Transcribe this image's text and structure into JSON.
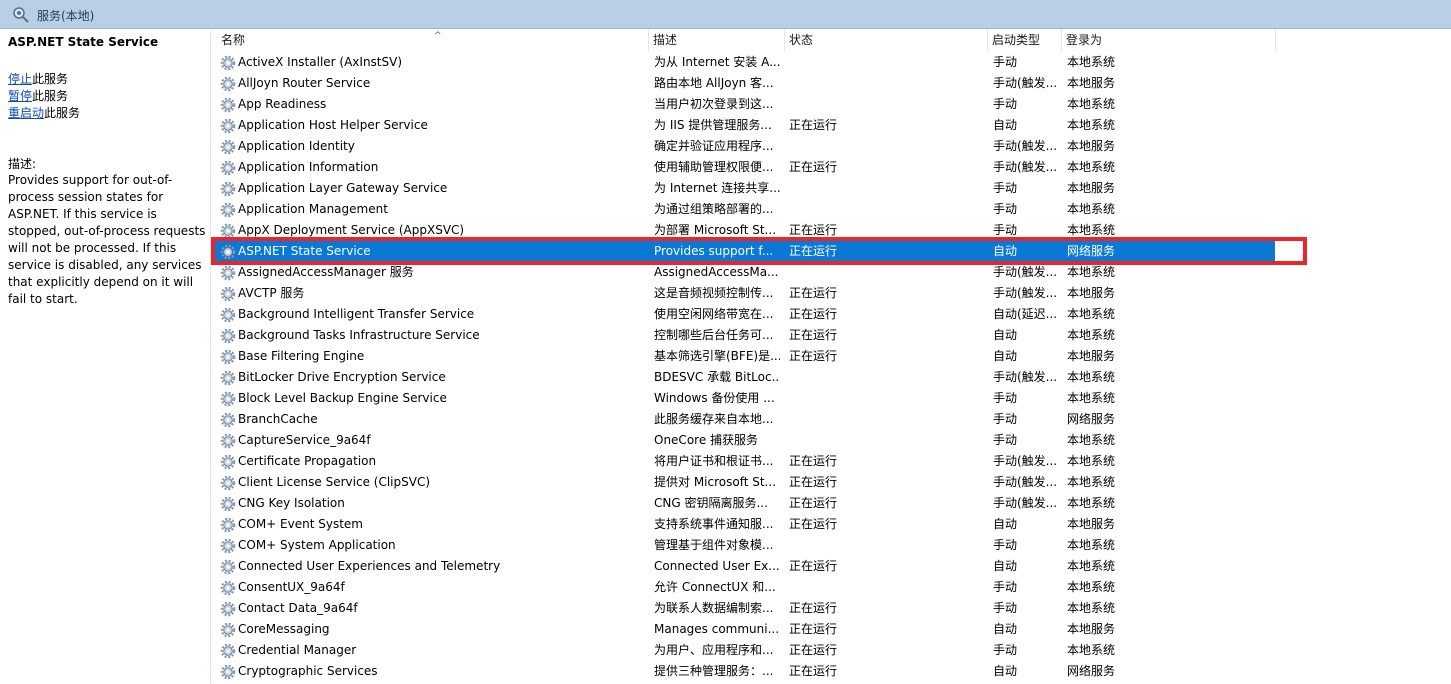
{
  "window": {
    "title": "服务(本地)"
  },
  "left_panel": {
    "service_title": "ASP.NET State Service",
    "actions": [
      {
        "link": "停止",
        "suffix": "此服务"
      },
      {
        "link": "暂停",
        "suffix": "此服务"
      },
      {
        "link": "重启动",
        "suffix": "此服务"
      }
    ],
    "description_label": "描述:",
    "description": "Provides support for out-of-process session states for ASP.NET. If this service is stopped, out-of-process requests will not be processed. If this service is disabled, any services that explicitly depend on it will fail to start."
  },
  "columns": {
    "name": "名称",
    "description": "描述",
    "status": "状态",
    "startup_type": "启动类型",
    "logon_as": "登录为",
    "sort_indicator": "^"
  },
  "selected_index": 9,
  "highlight_color": "#e8262b",
  "selection_color": "#0a79d6",
  "rows": [
    {
      "name": "ActiveX Installer (AxInstSV)",
      "desc": "为从 Internet 安装 A...",
      "status": "",
      "startup": "手动",
      "logon": "本地系统"
    },
    {
      "name": "AllJoyn Router Service",
      "desc": "路由本地 AllJoyn 客...",
      "status": "",
      "startup": "手动(触发...",
      "logon": "本地服务"
    },
    {
      "name": "App Readiness",
      "desc": "当用户初次登录到这...",
      "status": "",
      "startup": "手动",
      "logon": "本地系统"
    },
    {
      "name": "Application Host Helper Service",
      "desc": "为 IIS 提供管理服务...",
      "status": "正在运行",
      "startup": "自动",
      "logon": "本地系统"
    },
    {
      "name": "Application Identity",
      "desc": "确定并验证应用程序...",
      "status": "",
      "startup": "手动(触发...",
      "logon": "本地服务"
    },
    {
      "name": "Application Information",
      "desc": "使用辅助管理权限便...",
      "status": "正在运行",
      "startup": "手动(触发...",
      "logon": "本地系统"
    },
    {
      "name": "Application Layer Gateway Service",
      "desc": "为 Internet 连接共享...",
      "status": "",
      "startup": "手动",
      "logon": "本地服务"
    },
    {
      "name": "Application Management",
      "desc": "为通过组策略部署的...",
      "status": "",
      "startup": "手动",
      "logon": "本地系统"
    },
    {
      "name": "AppX Deployment Service (AppXSVC)",
      "desc": "为部署 Microsoft St...",
      "status": "正在运行",
      "startup": "手动",
      "logon": "本地系统"
    },
    {
      "name": "ASP.NET State Service",
      "desc": "Provides support f...",
      "status": "正在运行",
      "startup": "自动",
      "logon": "网络服务"
    },
    {
      "name": "AssignedAccessManager 服务",
      "desc": "AssignedAccessMa...",
      "status": "",
      "startup": "手动(触发...",
      "logon": "本地系统"
    },
    {
      "name": "AVCTP 服务",
      "desc": "这是音频视频控制传...",
      "status": "正在运行",
      "startup": "手动(触发...",
      "logon": "本地服务"
    },
    {
      "name": "Background Intelligent Transfer Service",
      "desc": "使用空闲网络带宽在...",
      "status": "正在运行",
      "startup": "自动(延迟...",
      "logon": "本地系统"
    },
    {
      "name": "Background Tasks Infrastructure Service",
      "desc": "控制哪些后台任务可...",
      "status": "正在运行",
      "startup": "自动",
      "logon": "本地系统"
    },
    {
      "name": "Base Filtering Engine",
      "desc": "基本筛选引擎(BFE)是...",
      "status": "正在运行",
      "startup": "自动",
      "logon": "本地服务"
    },
    {
      "name": "BitLocker Drive Encryption Service",
      "desc": "BDESVC 承载 BitLoc...",
      "status": "",
      "startup": "手动(触发...",
      "logon": "本地系统"
    },
    {
      "name": "Block Level Backup Engine Service",
      "desc": "Windows 备份使用 ...",
      "status": "",
      "startup": "手动",
      "logon": "本地系统"
    },
    {
      "name": "BranchCache",
      "desc": "此服务缓存来自本地...",
      "status": "",
      "startup": "手动",
      "logon": "网络服务"
    },
    {
      "name": "CaptureService_9a64f",
      "desc": "OneCore 捕获服务",
      "status": "",
      "startup": "手动",
      "logon": "本地系统"
    },
    {
      "name": "Certificate Propagation",
      "desc": "将用户证书和根证书...",
      "status": "正在运行",
      "startup": "手动(触发...",
      "logon": "本地系统"
    },
    {
      "name": "Client License Service (ClipSVC)",
      "desc": "提供对 Microsoft St...",
      "status": "正在运行",
      "startup": "手动(触发...",
      "logon": "本地系统"
    },
    {
      "name": "CNG Key Isolation",
      "desc": "CNG 密钥隔离服务...",
      "status": "正在运行",
      "startup": "手动(触发...",
      "logon": "本地系统"
    },
    {
      "name": "COM+ Event System",
      "desc": "支持系统事件通知服...",
      "status": "正在运行",
      "startup": "自动",
      "logon": "本地服务"
    },
    {
      "name": "COM+ System Application",
      "desc": "管理基于组件对象模...",
      "status": "",
      "startup": "手动",
      "logon": "本地系统"
    },
    {
      "name": "Connected User Experiences and Telemetry",
      "desc": "Connected User Ex...",
      "status": "正在运行",
      "startup": "自动",
      "logon": "本地系统"
    },
    {
      "name": "ConsentUX_9a64f",
      "desc": "允许 ConnectUX 和...",
      "status": "",
      "startup": "手动",
      "logon": "本地系统"
    },
    {
      "name": "Contact Data_9a64f",
      "desc": "为联系人数据编制索...",
      "status": "正在运行",
      "startup": "手动",
      "logon": "本地系统"
    },
    {
      "name": "CoreMessaging",
      "desc": "Manages communi...",
      "status": "正在运行",
      "startup": "自动",
      "logon": "本地服务"
    },
    {
      "name": "Credential Manager",
      "desc": "为用户、应用程序和...",
      "status": "正在运行",
      "startup": "手动",
      "logon": "本地系统"
    },
    {
      "name": "Cryptographic Services",
      "desc": "提供三种管理服务：...",
      "status": "正在运行",
      "startup": "自动",
      "logon": "网络服务"
    }
  ]
}
